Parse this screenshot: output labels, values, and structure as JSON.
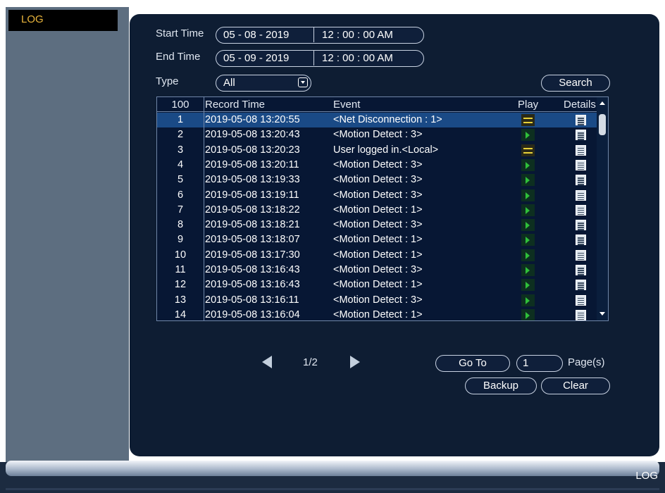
{
  "sidebar": {
    "active_tab": "LOG"
  },
  "filters": {
    "start_label": "Start Time",
    "start_date": "05 - 08 -  2019",
    "start_time": "12 : 00 : 00  AM",
    "end_label": "End Time",
    "end_date": "05 - 09 -  2019",
    "end_time": "12 : 00 : 00  AM",
    "type_label": "Type",
    "type_value": "All",
    "search_label": "Search"
  },
  "table": {
    "headers": {
      "count": "100",
      "record_time": "Record Time",
      "event": "Event",
      "play": "Play",
      "details": "Details"
    },
    "rows": [
      {
        "idx": "1",
        "time": "2019-05-08 13:20:55",
        "event": "<Net Disconnection : 1>",
        "play": "dash"
      },
      {
        "idx": "2",
        "time": "2019-05-08 13:20:43",
        "event": "<Motion Detect : 3>",
        "play": "play"
      },
      {
        "idx": "3",
        "time": "2019-05-08 13:20:23",
        "event": "User logged in.<Local>",
        "play": "dash"
      },
      {
        "idx": "4",
        "time": "2019-05-08 13:20:11",
        "event": "<Motion Detect : 3>",
        "play": "play"
      },
      {
        "idx": "5",
        "time": "2019-05-08 13:19:33",
        "event": "<Motion Detect : 3>",
        "play": "play"
      },
      {
        "idx": "6",
        "time": "2019-05-08 13:19:11",
        "event": "<Motion Detect : 3>",
        "play": "play"
      },
      {
        "idx": "7",
        "time": "2019-05-08 13:18:22",
        "event": "<Motion Detect : 1>",
        "play": "play"
      },
      {
        "idx": "8",
        "time": "2019-05-08 13:18:21",
        "event": "<Motion Detect : 3>",
        "play": "play"
      },
      {
        "idx": "9",
        "time": "2019-05-08 13:18:07",
        "event": "<Motion Detect : 1>",
        "play": "play"
      },
      {
        "idx": "10",
        "time": "2019-05-08 13:17:30",
        "event": "<Motion Detect : 1>",
        "play": "play"
      },
      {
        "idx": "11",
        "time": "2019-05-08 13:16:43",
        "event": "<Motion Detect : 3>",
        "play": "play"
      },
      {
        "idx": "12",
        "time": "2019-05-08 13:16:43",
        "event": "<Motion Detect : 1>",
        "play": "play"
      },
      {
        "idx": "13",
        "time": "2019-05-08 13:16:11",
        "event": "<Motion Detect : 3>",
        "play": "play"
      },
      {
        "idx": "14",
        "time": "2019-05-08 13:16:04",
        "event": "<Motion Detect : 1>",
        "play": "play"
      }
    ],
    "selected_row": 1
  },
  "pager": {
    "page_indicator": "1/2",
    "goto_label": "Go To",
    "page_input": "1",
    "pages_label": "Page(s)",
    "backup_label": "Backup",
    "clear_label": "Clear"
  },
  "footer": {
    "label": "LOG"
  },
  "colors": {
    "panel": "#0e1d33",
    "sidebar": "#5d6e80",
    "tab_text": "#e8b43c",
    "selected_row": "#1a4a86",
    "play_green": "#2fbf3a",
    "dash_yellow": "#e8d13a"
  },
  "icons": {
    "play": "play-icon",
    "no_record": "dash-icon",
    "details": "details-list-icon",
    "prev": "prev-page-icon",
    "next": "next-page-icon"
  }
}
